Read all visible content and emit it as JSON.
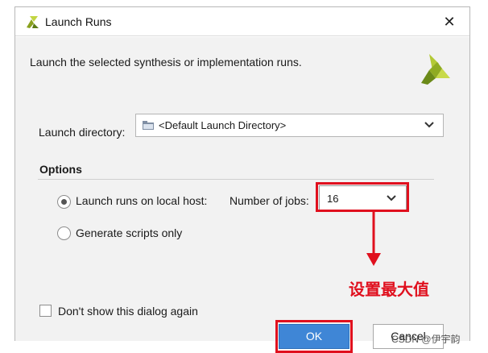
{
  "dialog": {
    "title": "Launch Runs",
    "close_icon": "close-icon",
    "description": "Launch the selected synthesis or implementation runs.",
    "logo_icon": "xilinx-logo-icon"
  },
  "launch_directory": {
    "label": "Launch directory:",
    "value": "<Default Launch Directory>",
    "folder_icon": "folder-icon"
  },
  "options": {
    "group_label": "Options",
    "local_host_label": "Launch runs on local host:",
    "local_host_selected": true,
    "jobs_label": "Number of jobs:",
    "jobs_value": "16",
    "generate_scripts_label": "Generate scripts only",
    "generate_scripts_selected": false
  },
  "annotation": {
    "text": "设置最大值",
    "color": "#e0101e"
  },
  "dont_show": {
    "label": "Don't show this dialog again",
    "checked": false
  },
  "buttons": {
    "ok": "OK",
    "cancel": "Cancel"
  },
  "watermark": "CSDN @伊宇韵",
  "colors": {
    "ok_button": "#3f86d6",
    "highlight": "#e0101e",
    "logo_green": "#a8c02c",
    "logo_dark": "#4e6b12"
  }
}
